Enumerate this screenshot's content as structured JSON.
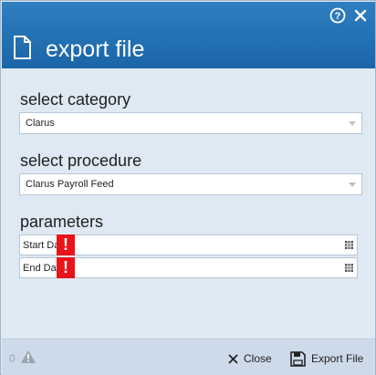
{
  "dialog": {
    "title": "export file",
    "help_icon": "help-circle-icon",
    "close_icon": "close-icon"
  },
  "category": {
    "label": "select category",
    "selected": "Clarus"
  },
  "procedure": {
    "label": "select procedure",
    "selected": "Clarus Payroll Feed"
  },
  "parameters": {
    "label": "parameters",
    "items": [
      {
        "label": "Start Date",
        "value": "",
        "error_mark": "!"
      },
      {
        "label": "End Date",
        "value": "",
        "error_mark": "!"
      }
    ]
  },
  "footer": {
    "error_count": "0",
    "close_label": "Close",
    "export_label": "Export File"
  },
  "colors": {
    "titlebar": "#1a65a8",
    "background": "#dfe9f3",
    "error": "#e8141a"
  }
}
